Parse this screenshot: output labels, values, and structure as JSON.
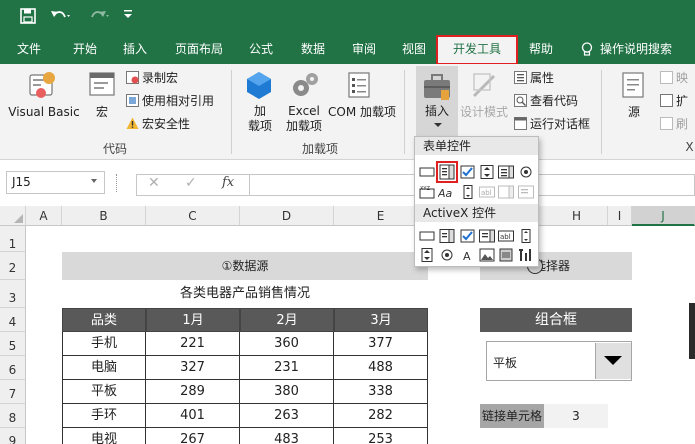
{
  "quick_access": {
    "save_icon": "save-icon",
    "undo_icon": "undo-icon",
    "redo_icon": "redo-icon",
    "customize_icon": "customize-icon"
  },
  "tabs": [
    "文件",
    "开始",
    "插入",
    "页面布局",
    "公式",
    "数据",
    "审阅",
    "视图",
    "开发工具",
    "帮助",
    "操作说明搜索"
  ],
  "active_tab": "开发工具",
  "ribbon": {
    "code": {
      "visual_basic": "Visual Basic",
      "macros": "宏",
      "record": "录制宏",
      "relative": "使用相对引用",
      "security": "宏安全性",
      "group": "代码"
    },
    "addins": {
      "addins_label": "加\n载项",
      "excel_addins": "Excel\n加载项",
      "com_addins": "COM 加载项",
      "group": "加载项"
    },
    "controls": {
      "insert": "插入",
      "design_mode": "设计模式",
      "properties": "属性",
      "view_code": "查看代码",
      "run_dialog": "运行对话框"
    },
    "xml": {
      "source": "源",
      "map": "映",
      "expand": "扩",
      "refresh": "刷",
      "group_partial": "X"
    }
  },
  "formula_bar": {
    "name_box": "J15",
    "cancel": "✕",
    "enter": "✓",
    "fx": "fx"
  },
  "columns": [
    "A",
    "B",
    "C",
    "D",
    "E",
    "F",
    "G",
    "H",
    "I",
    "J"
  ],
  "rows": [
    "1",
    "2",
    "3",
    "4",
    "5",
    "6",
    "7",
    "8",
    "9"
  ],
  "sheet": {
    "data_source_header": "①数据源",
    "selector_header": "选择器",
    "table_title": "各类电器产品销售情况",
    "table_headers": [
      "品类",
      "1月",
      "2月",
      "3月"
    ],
    "table_rows": [
      [
        "手机",
        "221",
        "360",
        "377"
      ],
      [
        "电脑",
        "327",
        "231",
        "488"
      ],
      [
        "平板",
        "289",
        "380",
        "338"
      ],
      [
        "手环",
        "401",
        "263",
        "282"
      ],
      [
        "电视",
        "267",
        "483",
        "253"
      ]
    ],
    "combo_title": "组合框",
    "combo_value": "平板",
    "link_label": "链接单元格",
    "link_value": "3"
  },
  "dropdown": {
    "form_controls": "表单控件",
    "activex_controls": "ActiveX 控件"
  },
  "colors": {
    "green": "#217346",
    "highlight": "#e02020",
    "table_header": "#595959",
    "band": "#d9d9d9"
  }
}
